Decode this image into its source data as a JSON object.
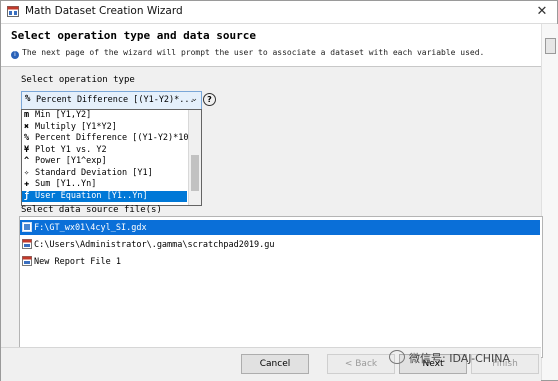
{
  "window": {
    "title": "Math Dataset Creation Wizard",
    "close_glyph": "✕"
  },
  "header": {
    "heading": "Select operation type and data source",
    "description": "The next page of the wizard will prompt the user to associate a dataset with each variable used."
  },
  "operation": {
    "label": "Select operation type",
    "selected_icon": "%",
    "selected_value": "Percent Difference [(Y1-Y2)*...",
    "help_glyph": "?",
    "options": [
      {
        "icon": "m",
        "label": "Min [Y1,Y2]"
      },
      {
        "icon": "✖",
        "label": "Multiply [Y1*Y2]"
      },
      {
        "icon": "%",
        "label": "Percent Difference [(Y1-Y2)*100/"
      },
      {
        "icon": "¥",
        "label": "Plot Y1 vs. Y2"
      },
      {
        "icon": "^",
        "label": "Power [Y1^exp]"
      },
      {
        "icon": "✧",
        "label": "Standard Deviation [Y1]"
      },
      {
        "icon": "✚",
        "label": "Sum [Y1..Yn]"
      },
      {
        "icon": "ƒ",
        "label": "User Equation [Y1..Yn]"
      }
    ]
  },
  "datasource": {
    "label": "Select data source file(s)",
    "files": [
      {
        "name": "F:\\GT_wx01\\4cyl_SI.gdx"
      },
      {
        "name": "C:\\Users\\Administrator\\.gamma\\scratchpad2019.gu"
      },
      {
        "name": "New Report File 1"
      }
    ]
  },
  "footer": {
    "cancel": "Cancel",
    "back": "< Back",
    "next": "Next",
    "finish": "Finish"
  },
  "watermark": "微信号: IDAJ-CHINA",
  "colors": {
    "selection": "#0078d7",
    "combo_bg": "#e5f0fb"
  }
}
